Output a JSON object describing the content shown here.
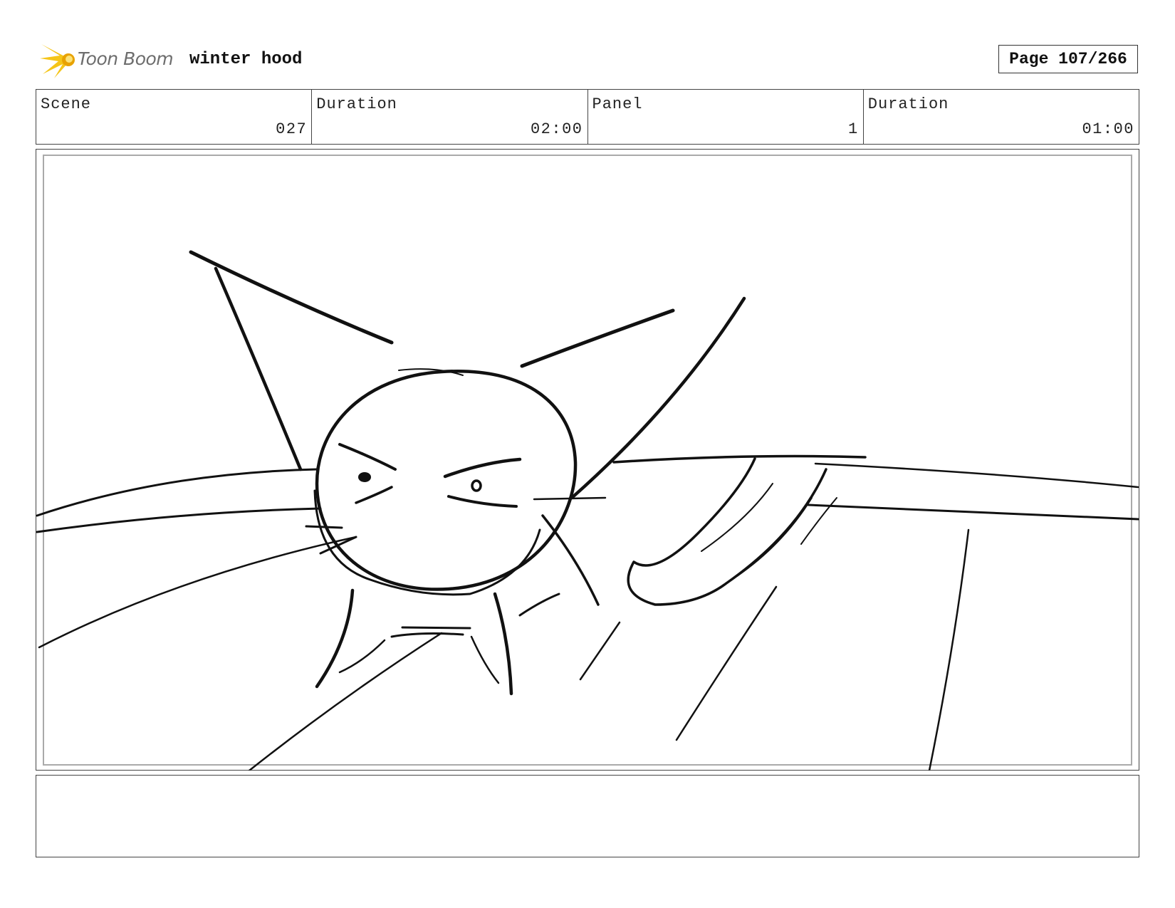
{
  "header": {
    "logo_text": "Toon Boom",
    "project_title": "winter hood",
    "page_label": "Page 107/266"
  },
  "info": {
    "scene_label": "Scene",
    "scene_value": "027",
    "scene_duration_label": "Duration",
    "scene_duration_value": "02:00",
    "panel_label": "Panel",
    "panel_value": "1",
    "panel_duration_label": "Duration",
    "panel_duration_value": "01:00"
  },
  "notes": {
    "text": ""
  },
  "colors": {
    "logo_flame": "#f5c518",
    "logo_flame_dark": "#e8a200",
    "logo_text": "#6d6d6d",
    "border": "#444444",
    "inner_frame": "#aaaaaa"
  }
}
